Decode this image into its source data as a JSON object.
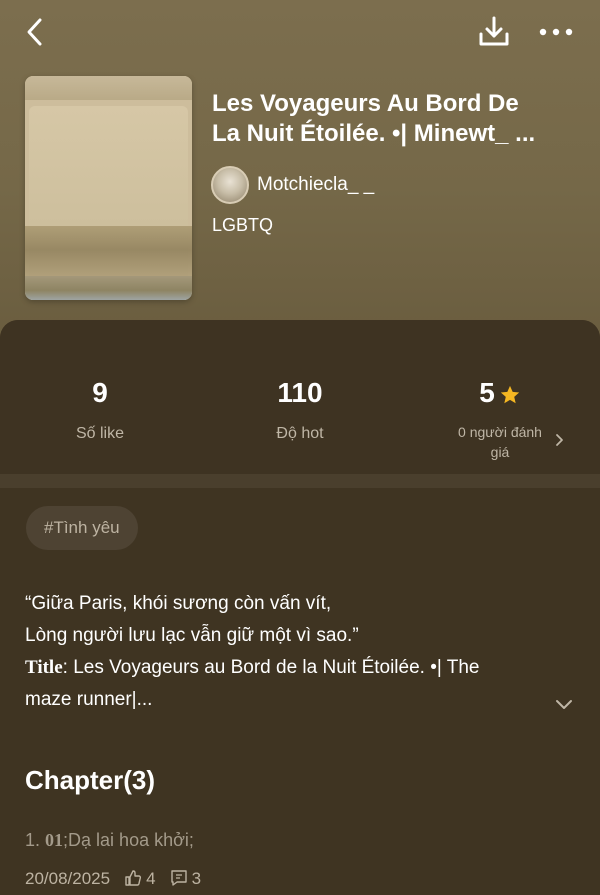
{
  "header": {
    "back_icon": "chevron-left-icon",
    "download_icon": "download-icon",
    "more_icon": "more-horizontal-icon"
  },
  "book": {
    "title_line1": "Les Voyageurs Au Bord De",
    "title_line2": "La Nuit Étoilée. •| Minewt_ ...",
    "author": "Motchiecla_ _",
    "category": "LGBTQ"
  },
  "stats": {
    "likes": {
      "value": "9",
      "label": "Số like"
    },
    "hot": {
      "value": "110",
      "label": "Độ hot"
    },
    "rating": {
      "value": "5",
      "label_line1": "0 người đánh",
      "label_line2": "giá",
      "icon": "star-icon"
    }
  },
  "tags": [
    "#Tình yêu"
  ],
  "description": {
    "line1": "“Giữa Paris, khói sương còn vấn vít,",
    "line2": "Lòng người lưu lạc vẫn giữ một vì sao.”",
    "title_label": "Title",
    "line3_rest": ": Les Voyageurs au Bord de la Nuit Étoilée. •| The",
    "line4": "maze runner|..."
  },
  "chapters": {
    "heading": "Chapter(3)",
    "items": [
      {
        "index": "1.",
        "num": "01",
        "title": ";Dạ lai hoa khởi;",
        "date": "20/08/2025",
        "likes": "4",
        "comments": "3"
      }
    ]
  },
  "colors": {
    "hero_bg": "#776a4a",
    "panel_bg": "#3f3422",
    "accent_star": "#f5b722",
    "muted_text": "#bfb6a6"
  }
}
